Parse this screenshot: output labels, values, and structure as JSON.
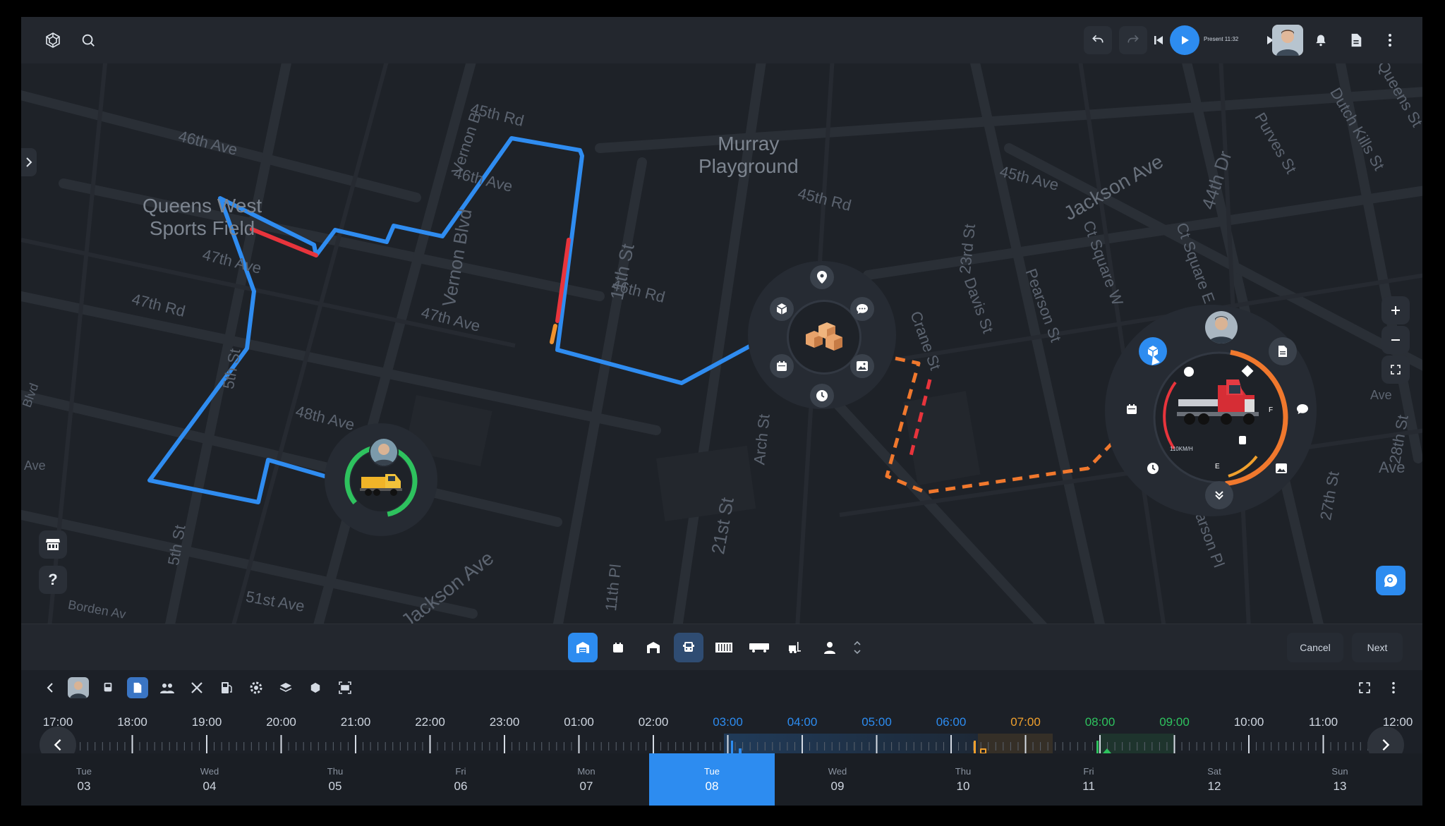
{
  "topbar": {
    "logo_icon": "cube-network-icon",
    "search_icon": "search-icon",
    "undo_icon": "undo-icon",
    "redo_icon": "redo-icon",
    "prev_icon": "skip-back-icon",
    "play_icon": "play-icon",
    "present_label": "Present 11:32",
    "next_icon": "skip-forward-icon",
    "bell_icon": "bell-icon",
    "doc_icon": "document-icon",
    "more_icon": "more-vertical-icon"
  },
  "map": {
    "streets": [
      "46th Ave",
      "45th Rd",
      "Vernon B",
      "46th Ave",
      "45th Rd",
      "45th Ave",
      "Jackson Ave",
      "44th Dr",
      "Purves St",
      "Dutch Kills St",
      "Queens St",
      "47th Ave",
      "47th Rd",
      "46th Rd",
      "47th Ave",
      "11th St",
      "Vernon Blvd",
      "46th Ave",
      "Crane St",
      "23rd St",
      "Davis St",
      "Pearson St",
      "Ct Square W",
      "Ct Square E",
      "28th St",
      "27th St",
      "48th Ave",
      "5th St",
      "5th St",
      "Arch St",
      "21st St",
      "11th Pl",
      "51st Ave",
      "Jackson Ave",
      "Borden Av",
      "Blvd",
      "Ave",
      "Ave",
      "Ave",
      "Pearson Pl"
    ],
    "places": [
      "Queens West\nSports Field",
      "Murray\nPlayground"
    ],
    "route_colors": {
      "normal": "#2f8cf0",
      "delay": "#e8343c",
      "warning": "#f0922d",
      "planned": "#f0782d"
    },
    "speed_label": "110KM/H",
    "fuel_full": "F",
    "fuel_empty": "E"
  },
  "toolbar": {
    "cancel_label": "Cancel",
    "next_label": "Next"
  },
  "timeline": {
    "hours": [
      "17:00",
      "18:00",
      "19:00",
      "20:00",
      "21:00",
      "22:00",
      "23:00",
      "01:00",
      "02:00",
      "03:00",
      "04:00",
      "05:00",
      "06:00",
      "07:00",
      "08:00",
      "09:00",
      "10:00",
      "11:00",
      "12:00"
    ],
    "hour_colors": {
      "03:00": "#2d8cf0",
      "04:00": "#2d8cf0",
      "05:00": "#2d8cf0",
      "06:00": "#2d8cf0",
      "07:00": "#f0a02d",
      "08:00": "#2ec25e",
      "09:00": "#2ec25e"
    }
  },
  "days": [
    {
      "name": "Tue",
      "date": "03"
    },
    {
      "name": "Wed",
      "date": "04"
    },
    {
      "name": "Thu",
      "date": "05"
    },
    {
      "name": "Fri",
      "date": "06"
    },
    {
      "name": "Mon",
      "date": "07"
    },
    {
      "name": "Tue",
      "date": "08"
    },
    {
      "name": "Wed",
      "date": "09"
    },
    {
      "name": "Thu",
      "date": "10"
    },
    {
      "name": "Fri",
      "date": "11"
    },
    {
      "name": "Sat",
      "date": "12"
    },
    {
      "name": "Sun",
      "date": "13"
    }
  ],
  "selected_day_index": 5
}
